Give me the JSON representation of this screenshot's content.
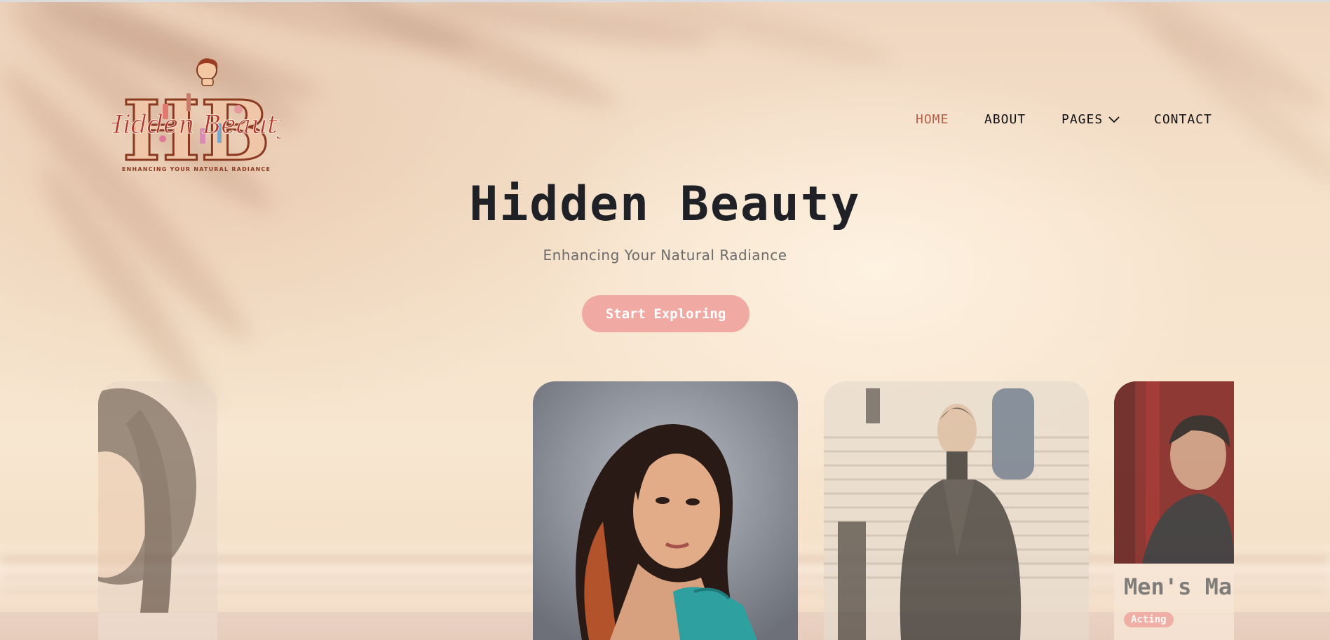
{
  "logo": {
    "monogram": "HB",
    "script_text": "Hidden Beauty",
    "tagline": "ENHANCING YOUR NATURAL RADIANCE"
  },
  "nav": {
    "items": [
      {
        "label": "HOME",
        "active": true
      },
      {
        "label": "ABOUT",
        "active": false
      },
      {
        "label": "PAGES",
        "active": false,
        "has_dropdown": true
      },
      {
        "label": "CONTACT",
        "active": false
      }
    ]
  },
  "hero": {
    "title": "Hidden Beauty",
    "subtitle": "Enhancing Your Natural Radiance",
    "cta_label": "Start Exploring"
  },
  "cards": {
    "right_partial": {
      "title": "Men's Ma",
      "tag": "Acting"
    }
  },
  "colors": {
    "accent": "#f1aaa3",
    "nav_active": "#b4614a",
    "title": "#1f2127"
  },
  "icons": {
    "pages_dropdown": "chevron-down-icon"
  }
}
